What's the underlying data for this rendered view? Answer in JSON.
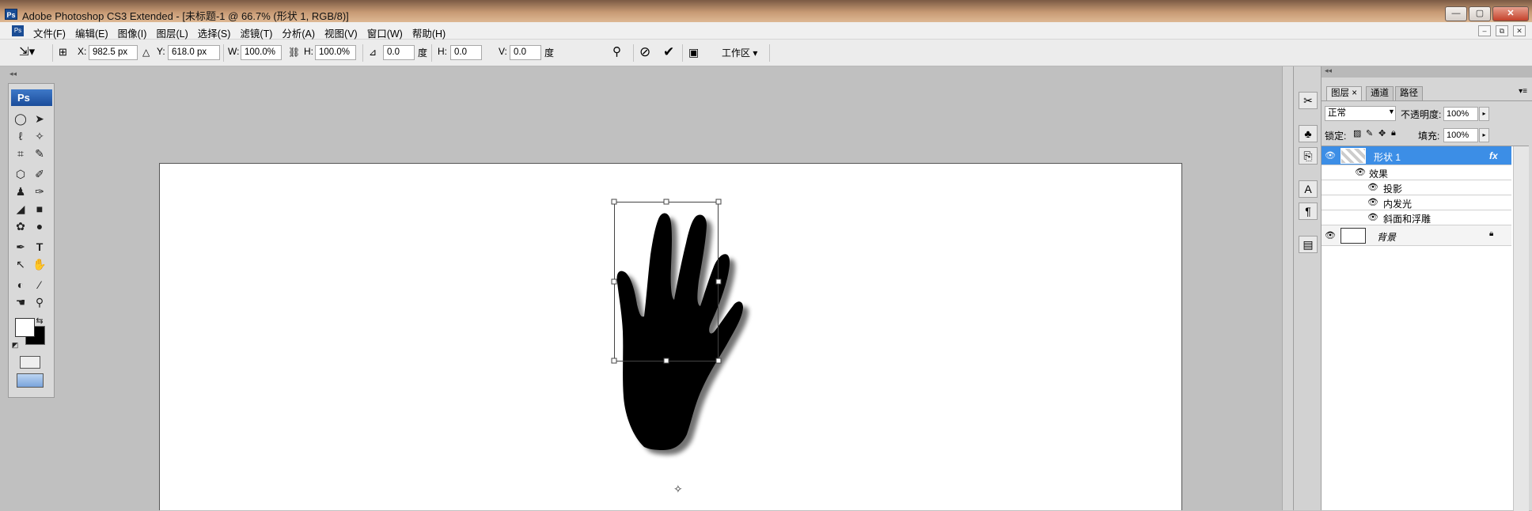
{
  "app": {
    "ps_badge": "Ps",
    "title": "Adobe Photoshop CS3 Extended - [未标题-1 @ 66.7% (形状 1, RGB/8)]",
    "window_buttons": [
      "—",
      "▢",
      "✕"
    ],
    "mdi_buttons": [
      "–",
      "⧉",
      "✕"
    ]
  },
  "menu": {
    "items": [
      "文件(F)",
      "编辑(E)",
      "图像(I)",
      "图层(L)",
      "选择(S)",
      "滤镜(T)",
      "分析(A)",
      "视图(V)",
      "窗口(W)",
      "帮助(H)"
    ]
  },
  "options": {
    "x_label": "X:",
    "x_value": "982.5 px",
    "y_label": "Y:",
    "y_value": "618.0 px",
    "w_label": "W:",
    "w_value": "100.0%",
    "h_label": "H:",
    "h_value": "100.0%",
    "angle_value": "0.0",
    "angle_unit": "度",
    "hskew_label": "H:",
    "hskew_value": "0.0",
    "vskew_label": "V:",
    "vskew_value": "0.0",
    "skew_unit": "度",
    "workspace_label": "工作区 ▾"
  },
  "toolbox": {
    "badge": "Ps",
    "grip": "◂◂"
  },
  "panel": {
    "grip": "◂◂",
    "tabs": [
      "图层 ×",
      "通道",
      "路径"
    ],
    "blend_mode": "正常",
    "opacity_label": "不透明度:",
    "opacity_value": "100%",
    "lock_label": "锁定:",
    "fill_label": "填充:",
    "fill_value": "100%"
  },
  "layers": {
    "shape_layer": "形状 1",
    "fx_badge": "fx",
    "effects_label": "效果",
    "effects": [
      "投影",
      "内发光",
      "斜面和浮雕"
    ],
    "background_layer": "背景"
  },
  "colors": {
    "selected_layer": "#3c8ee6",
    "canvas_bg": "#c0c0c0",
    "hand": "#000000"
  }
}
